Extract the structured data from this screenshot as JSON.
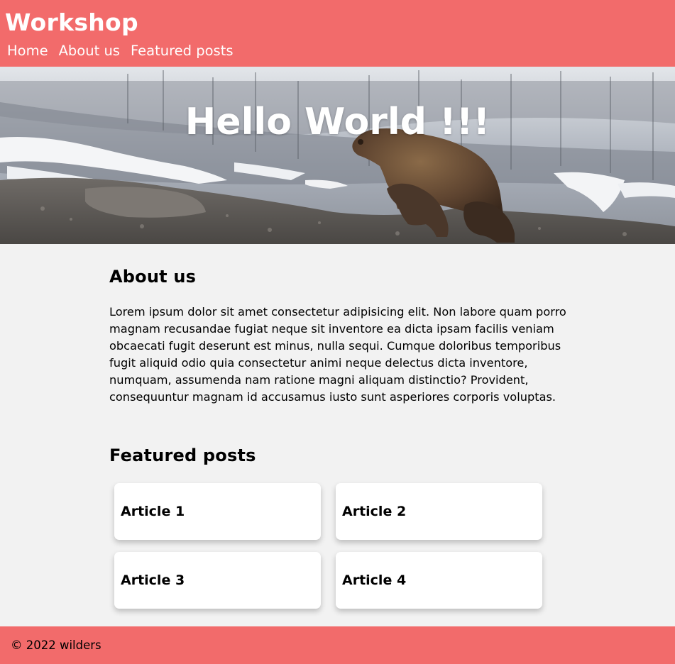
{
  "header": {
    "title": "Workshop",
    "nav": [
      "Home",
      "About us",
      "Featured posts"
    ]
  },
  "hero": {
    "title": "Hello World !!!"
  },
  "about": {
    "heading": "About us",
    "text": "Lorem ipsum dolor sit amet consectetur adipisicing elit. Non labore quam porro magnam recusandae fugiat neque sit inventore ea dicta ipsam facilis veniam obcaecati fugit deserunt est minus, nulla sequi. Cumque doloribus temporibus fugit aliquid odio quia consectetur animi neque delectus dicta inventore, numquam, assumenda nam ratione magni aliquam distinctio? Provident, consequuntur magnam id accusamus iusto sunt asperiores corporis voluptas."
  },
  "featured": {
    "heading": "Featured posts",
    "articles": [
      "Article 1",
      "Article 2",
      "Article 3",
      "Article 4"
    ]
  },
  "footer": {
    "text": "© 2022 wilders"
  },
  "colors": {
    "accent": "#f26b6b",
    "background": "#f2f2f2",
    "card": "#ffffff"
  }
}
